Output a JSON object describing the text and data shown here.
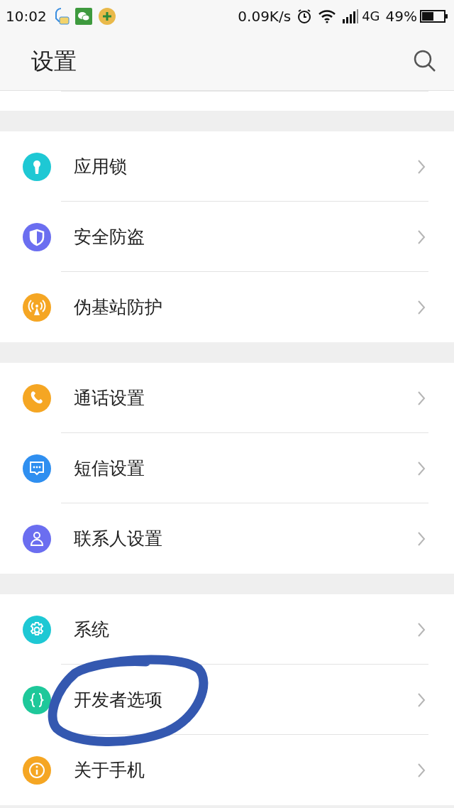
{
  "status_bar": {
    "time": "10:02",
    "speed": "0.09K/s",
    "network": "4G",
    "battery": "49%"
  },
  "header": {
    "title": "设置"
  },
  "groups": [
    {
      "items": [
        {
          "label": "应用锁",
          "kind": "lock",
          "color": "#1ec8d4"
        },
        {
          "label": "安全防盗",
          "kind": "shield",
          "color": "#6b6ef0"
        },
        {
          "label": "伪基站防护",
          "kind": "antenna",
          "color": "#f5a623"
        }
      ]
    },
    {
      "items": [
        {
          "label": "通话设置",
          "kind": "phone",
          "color": "#f5a623"
        },
        {
          "label": "短信设置",
          "kind": "message",
          "color": "#2f8ff0"
        },
        {
          "label": "联系人设置",
          "kind": "contact",
          "color": "#6b6ef0"
        }
      ]
    },
    {
      "items": [
        {
          "label": "系统",
          "kind": "gear",
          "color": "#1ec8d4"
        },
        {
          "label": "开发者选项",
          "kind": "code",
          "color": "#1ec89a"
        },
        {
          "label": "关于手机",
          "kind": "info",
          "color": "#f5a623"
        }
      ]
    }
  ]
}
